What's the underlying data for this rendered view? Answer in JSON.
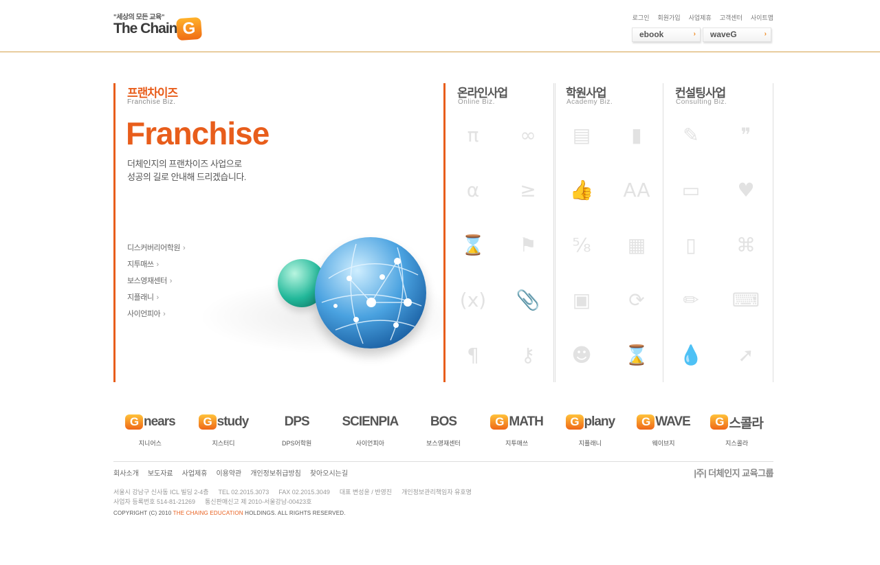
{
  "header": {
    "tagline": "\"세상의 모든 교육\"",
    "logo_text": "The Chain",
    "logo_g": "G",
    "util_links": [
      "로그인",
      "회원가입",
      "사업제휴",
      "고객센터",
      "사이트맵"
    ],
    "buttons": [
      {
        "label": "ebook",
        "arrow": "›"
      },
      {
        "label": "waveG",
        "arrow": "›"
      }
    ]
  },
  "franchise": {
    "title_ko": "프랜차이즈",
    "title_en": "Franchise Biz.",
    "headline": "Franchise",
    "desc_lines": [
      "더체인지의 프랜차이즈 사업으로",
      "성공의 길로 안내해 드리겠습니다."
    ],
    "links": [
      "디스커버리어학원",
      "지투매쓰",
      "보스영재센터",
      "지플래니",
      "사이언피아"
    ],
    "chevron": "›"
  },
  "columns": [
    {
      "title_ko": "온라인사업",
      "title_en": "Online Biz.",
      "icons": [
        {
          "name": "pi-icon",
          "glyph": "π"
        },
        {
          "name": "infinity-icon",
          "glyph": "∞"
        },
        {
          "name": "alpha-icon",
          "glyph": "α"
        },
        {
          "name": "greater-equal-icon",
          "glyph": "≥"
        },
        {
          "name": "hourglass-icon",
          "glyph": "⌛"
        },
        {
          "name": "flag-icon",
          "glyph": "⚑"
        },
        {
          "name": "parentheses-x-icon",
          "glyph": "(x)"
        },
        {
          "name": "paperclip-icon",
          "glyph": "📎"
        },
        {
          "name": "pilcrow-icon",
          "glyph": "¶"
        },
        {
          "name": "key-icon",
          "glyph": "⚷"
        }
      ]
    },
    {
      "title_ko": "학원사업",
      "title_en": "Academy Biz.",
      "icons": [
        {
          "name": "document-icon",
          "glyph": "▤"
        },
        {
          "name": "book-icon",
          "glyph": "▮"
        },
        {
          "name": "thumbs-up-icon",
          "glyph": "👍"
        },
        {
          "name": "font-size-icon",
          "glyph": "AA"
        },
        {
          "name": "fraction-icon",
          "glyph": "⅝"
        },
        {
          "name": "notebook-icon",
          "glyph": "▦"
        },
        {
          "name": "calculator-icon",
          "glyph": "▣"
        },
        {
          "name": "refresh-icon",
          "glyph": "⟳"
        },
        {
          "name": "people-icon",
          "glyph": "☻"
        },
        {
          "name": "hourglass-icon",
          "glyph": "⌛"
        }
      ]
    },
    {
      "title_ko": "컨설팅사업",
      "title_en": "Consulting Biz.",
      "icons": [
        {
          "name": "pen-icon",
          "glyph": "✎"
        },
        {
          "name": "quote-icon",
          "glyph": "❞"
        },
        {
          "name": "laptop-icon",
          "glyph": "▭"
        },
        {
          "name": "heart-icon",
          "glyph": "♥"
        },
        {
          "name": "clipboard-icon",
          "glyph": "▯"
        },
        {
          "name": "command-icon",
          "glyph": "⌘"
        },
        {
          "name": "pencil-icon",
          "glyph": "✏"
        },
        {
          "name": "keyboard-icon",
          "glyph": "⌨"
        },
        {
          "name": "drop-icon",
          "glyph": "💧"
        },
        {
          "name": "external-arrow-icon",
          "glyph": "➚"
        }
      ]
    }
  ],
  "brands": [
    {
      "logo_g": "G",
      "logo_text": "nears",
      "name": "지니어스"
    },
    {
      "logo_g": "G",
      "logo_text": "study",
      "name": "지스터디"
    },
    {
      "logo_g": "",
      "logo_text": "DPS",
      "name": "DPS어학원"
    },
    {
      "logo_g": "",
      "logo_text": "SCIENPIA",
      "name": "사이언피아"
    },
    {
      "logo_g": "",
      "logo_text": "BOS",
      "name": "보스영재센터"
    },
    {
      "logo_g": "G",
      "logo_text": "MATH",
      "name": "지투매쓰"
    },
    {
      "logo_g": "G",
      "logo_text": "plany",
      "name": "지플래니"
    },
    {
      "logo_g": "G",
      "logo_text": "WAVE",
      "name": "웨이브지"
    },
    {
      "logo_g": "G",
      "logo_text": "스콜라",
      "name": "지스콜라"
    }
  ],
  "footer": {
    "links": [
      "회사소개",
      "보도자료",
      "사업제휴",
      "이용약관",
      "개인정보취급방침",
      "찾아오시는길"
    ],
    "corp_name": "|주| 더체인지 교육그룹",
    "addr_line1": [
      "서울시 강남구 신사동 ICL 빌딩 2-4층",
      "TEL 02.2015.3073",
      "FAX 02.2015.3049",
      "대표 변성윤 / 반영진",
      "개인정보관리책임자 유호명"
    ],
    "addr_line2": [
      "사업자 등록번호 514-81-21269",
      "통신판매신고 제 2010-서울강남-00423호"
    ],
    "copyright_pre": "COPYRIGHT (C) 2010 ",
    "copyright_hl": "THE CHAING EDUCATION",
    "copyright_post": " HOLDINGS. ALL RIGHTS RESERVED."
  },
  "colors": {
    "accent": "#e85d1b",
    "header_line": "#d4a14a",
    "icon_gray": "#e2e2e2"
  }
}
